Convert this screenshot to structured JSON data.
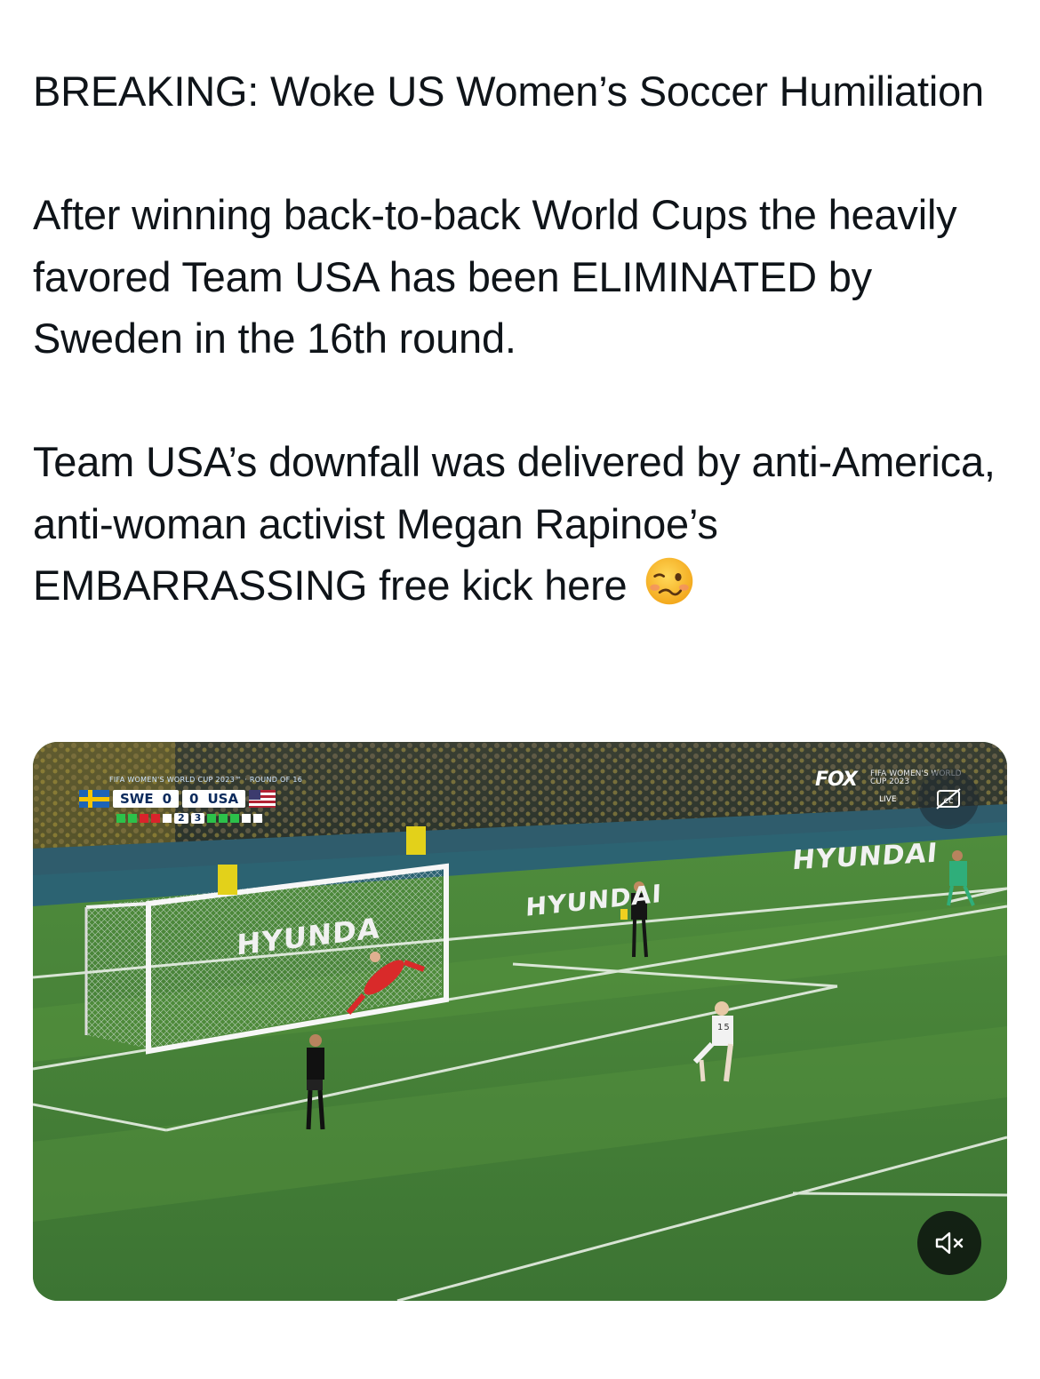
{
  "tweet": {
    "paragraphs": [
      "BREAKING: Woke US Women’s Soccer Humiliation",
      "After winning back-to-back World Cups the heavily favored Team USA has been ELIMINATED by Sweden in the 16th round.",
      "Team USA’s downfall was delivered by anti-America, anti-woman activist Megan Rapinoe’s EMBARRASSING free kick here"
    ],
    "trailing_emoji": "woozy-face"
  },
  "video": {
    "scorebug": {
      "competition": "FIFA WOMEN'S WORLD CUP 2023™ · ROUND OF 16",
      "home_team": "SWE",
      "home_score": "0",
      "away_team": "USA",
      "away_score": "0",
      "home_pens": "2",
      "away_pens": "3"
    },
    "broadcaster": {
      "network": "FOX",
      "event": "FIFA WOMEN'S WORLD CUP 2023",
      "live": "LIVE"
    },
    "ad_boards": [
      "HYUNDAI",
      "HYUNDAI",
      "HYUNDA"
    ],
    "player_number": "15",
    "controls": {
      "captions_icon": "closed-captions-off-icon",
      "mute_icon": "speaker-muted-icon"
    }
  }
}
